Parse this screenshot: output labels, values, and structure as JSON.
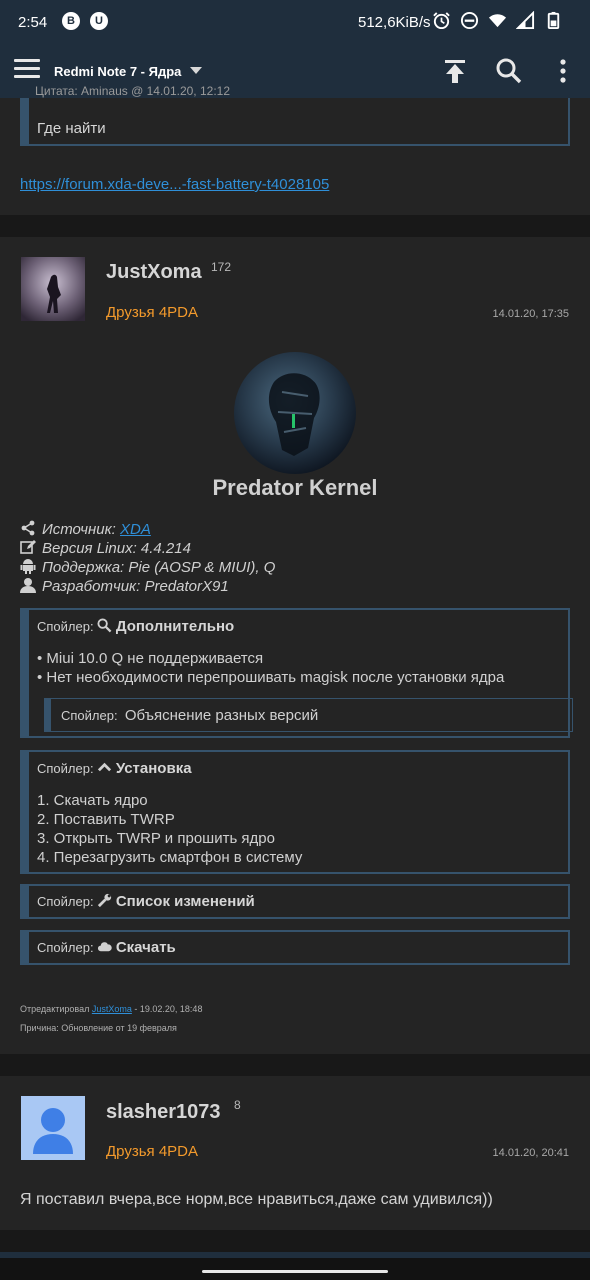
{
  "status": {
    "time": "2:54",
    "badge1": "B",
    "badge2": "U",
    "speed": "512,6KiB/s",
    "icons": [
      "alarm-icon",
      "dnd-icon",
      "wifi-icon",
      "signal-icon",
      "battery-icon"
    ]
  },
  "appbar": {
    "title": "Redmi Note 7 - Ядра",
    "icons": [
      "menu-icon",
      "scroll-top-icon",
      "search-icon",
      "more-icon"
    ]
  },
  "post0": {
    "quote_header": "Цитата: Aminaus @ 14.01.20, 12:12",
    "quote_text": "Где найти",
    "link": "https://forum.xda-deve...-fast-battery-t4028105"
  },
  "post1": {
    "username": "JustXoma",
    "reputation": "172",
    "group": "Друзья 4PDA",
    "date": "14.01.20, 17:35",
    "kernel_title": "Predator Kernel",
    "info": {
      "source_label": "Источник:",
      "source_link": "XDA",
      "linux": "Версия Linux: 4.4.214",
      "support": "Поддержка: Pie (AOSP & MIUI), Q",
      "developer": "Разработчик: PredatorX91"
    },
    "spoiler_label": "Спойлер:",
    "spoilers": {
      "extra_title": "Дополнительно",
      "extra_line1": "• Miui 10.0 Q не поддерживается",
      "extra_line2": "• Нет необходимости перепрошивать magisk после установки ядра",
      "versions_title": "Объяснение разных версий",
      "install_title": "Установка",
      "install_steps": [
        "1.   Скачать ядро",
        "2.   Поставить TWRP",
        "3.   Открыть TWRP и прошить ядро",
        "4.   Перезагрузить смартфон в систему"
      ],
      "changelog_title": "Список изменений",
      "download_title": "Скачать"
    },
    "edited_prefix": "Отредактировал",
    "edited_by": "JustXoma",
    "edited_date": "- 19.02.20, 18:48",
    "reason": "Причина: Обновление от 19 февраля"
  },
  "post2": {
    "username": "slasher1073",
    "reputation": "8",
    "group": "Друзья 4PDA",
    "date": "14.01.20, 20:41",
    "text": "Я поставил вчера,все норм,все нравиться,даже сам удивился))"
  },
  "colors": {
    "appbar": "#1f2e3d",
    "spoiler_border": "#36536c",
    "link": "#2f8fd8",
    "group": "#f39a2c",
    "card": "#242424",
    "background": "#181818"
  }
}
